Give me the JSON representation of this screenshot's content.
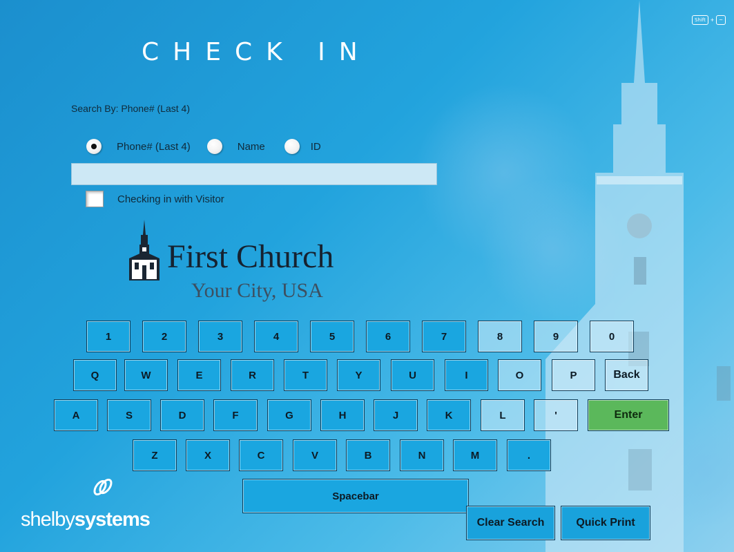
{
  "title": "CHECK IN",
  "shortcut": {
    "shift": "Shift",
    "plus": "+",
    "tilde": "~"
  },
  "search": {
    "by_label": "Search By: Phone# (Last 4)",
    "options": [
      {
        "label": "Phone# (Last 4)",
        "selected": true
      },
      {
        "label": "Name",
        "selected": false
      },
      {
        "label": "ID",
        "selected": false
      }
    ],
    "value": "",
    "placeholder": ""
  },
  "visitor": {
    "label": "Checking in with Visitor",
    "checked": false
  },
  "logo": {
    "name": "First Church",
    "city": "Your City, USA"
  },
  "keyboard": {
    "row1": [
      "1",
      "2",
      "3",
      "4",
      "5",
      "6",
      "7",
      "8",
      "9",
      "0"
    ],
    "row2": [
      "Q",
      "W",
      "E",
      "R",
      "T",
      "Y",
      "U",
      "I",
      "O",
      "P",
      "Back"
    ],
    "row3": [
      "A",
      "S",
      "D",
      "F",
      "G",
      "H",
      "J",
      "K",
      "L",
      "'",
      "Enter"
    ],
    "row4": [
      "Z",
      "X",
      "C",
      "V",
      "B",
      "N",
      "M",
      "."
    ],
    "space": "Spacebar"
  },
  "buttons": {
    "clear": "Clear Search",
    "print": "Quick Print"
  },
  "brand": {
    "part1": "shelby",
    "part2": "systems"
  },
  "colors": {
    "background": "#22a3dd",
    "enter": "#5bb85b",
    "key": "#1aa6e0"
  }
}
